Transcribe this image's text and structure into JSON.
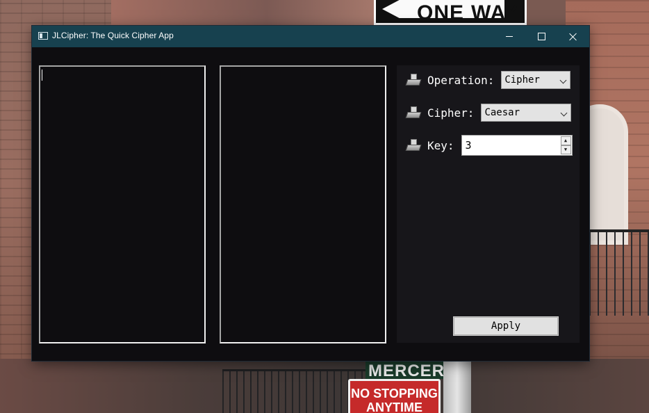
{
  "background": {
    "sign_one_way_left": "ONE",
    "sign_one_way_right": "WAY",
    "sign_street": "MERCER ST",
    "sign_no_stopping": "NO STOPPING ANYTIME"
  },
  "window": {
    "title": "JLCipher: The Quick Cipher App",
    "icon": "app-window-icon",
    "controls": [
      "minimize",
      "maximize",
      "close"
    ],
    "titlebar_color": "#17414f"
  },
  "main": {
    "input_text": "",
    "output_text": ""
  },
  "settings": {
    "operation": {
      "label": "Operation:",
      "value": "Cipher",
      "icon": "keyboard-icon"
    },
    "cipher": {
      "label": "Cipher:",
      "value": "Caesar",
      "icon": "keyboard-icon"
    },
    "key": {
      "label": "Key:",
      "value": "3",
      "icon": "keyboard-icon"
    }
  },
  "actions": {
    "apply_label": "Apply"
  }
}
